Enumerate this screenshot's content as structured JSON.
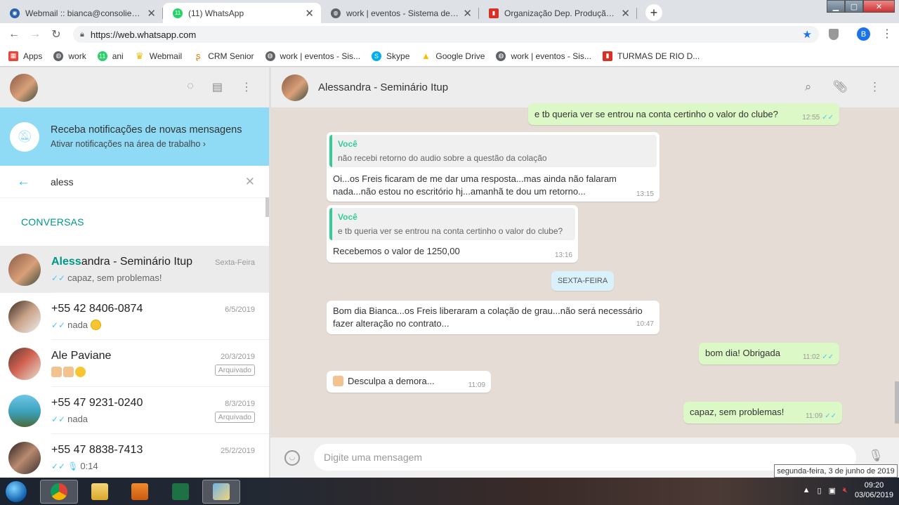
{
  "browser": {
    "tabs": [
      {
        "title": "Webmail :: bianca@consolievent...",
        "icon": "webmail-icon",
        "color": "#2a63a8",
        "active": false
      },
      {
        "title": "(11) WhatsApp",
        "icon": "whatsapp-icon",
        "color": "#25d366",
        "active": true
      },
      {
        "title": "work | eventos - Sistema de Gest...",
        "icon": "globe-icon",
        "color": "#5f6368",
        "active": false
      },
      {
        "title": "Organização Dep. Produção | Tre...",
        "icon": "trello-icon",
        "color": "#d93025",
        "active": false
      }
    ],
    "url": "https://web.whatsapp.com",
    "profile_initial": "B",
    "bookmarks": [
      {
        "label": "Apps",
        "icon": "apps-grid-icon",
        "color": "#e8453c"
      },
      {
        "label": "work",
        "icon": "globe-icon",
        "color": "#5f6368"
      },
      {
        "label": "ani",
        "icon": "whatsapp-icon",
        "color": "#25d366"
      },
      {
        "label": "Webmail",
        "icon": "crown-icon",
        "color": "#e6b800"
      },
      {
        "label": "CRM Senior",
        "icon": "crm-icon",
        "color": "#e07b00"
      },
      {
        "label": "work | eventos - Sis...",
        "icon": "globe-icon",
        "color": "#5f6368"
      },
      {
        "label": "Skype",
        "icon": "skype-icon",
        "color": "#00aff0"
      },
      {
        "label": "Google Drive",
        "icon": "drive-icon",
        "color": "#fbbc04"
      },
      {
        "label": "work | eventos - Sis...",
        "icon": "globe-icon",
        "color": "#5f6368"
      },
      {
        "label": "TURMAS DE RIO D...",
        "icon": "trello-icon",
        "color": "#d93025"
      }
    ]
  },
  "sidebar": {
    "notification": {
      "title": "Receba notificações de novas mensagens",
      "link": "Ativar notificações na área de trabalho ›"
    },
    "search_value": "aless",
    "section_title": "CONVERSAS",
    "chats": [
      {
        "name_match": "Aless",
        "name_rest": "andra - Seminário Itup",
        "date": "Sexta-Feira",
        "preview": "capaz, sem problemas!",
        "archived": "",
        "selected": true
      },
      {
        "name_match": "",
        "name_rest": "+55 42 8406-0874",
        "date": "6/5/2019",
        "preview": "nada",
        "archived": "",
        "selected": false
      },
      {
        "name_match": "",
        "name_rest": "Ale Paviane",
        "date": "20/3/2019",
        "preview": "",
        "archived": "Arquivado",
        "selected": false
      },
      {
        "name_match": "",
        "name_rest": "+55 47 9231-0240",
        "date": "8/3/2019",
        "preview": "nada",
        "archived": "Arquivado",
        "selected": false
      },
      {
        "name_match": "",
        "name_rest": "+55 47 8838-7413",
        "date": "25/2/2019",
        "preview": "0:14",
        "archived": "",
        "selected": false
      }
    ]
  },
  "conversation": {
    "contact_name": "Alessandra - Seminário Itup",
    "messages": [
      {
        "text": "e tb queria ver se entrou na conta certinho o valor do clube?",
        "time": "12:55"
      },
      {
        "quote_author": "Você",
        "quote_text": "não recebi retorno do audio sobre a questão da colação",
        "text1": "Oi...os Freis ficaram de me dar uma resposta...mas ainda não falaram",
        "text2": "nada...não estou no escritório hj...amanhã te dou um retorno...",
        "time": "13:15"
      },
      {
        "quote_author": "Você",
        "quote_text": "e tb queria ver se entrou na conta certinho o valor do clube?",
        "text": "Recebemos o valor de 1250,00",
        "time": "13:16"
      },
      {
        "text1": "Bom dia Bianca...os Freis liberaram a colação de grau...não será necessário",
        "text2": "fazer alteração no contrato...",
        "time": "10:47"
      },
      {
        "text": "bom dia! Obrigada",
        "time": "11:02"
      },
      {
        "text": "Desculpa a demora...",
        "time": "11:09"
      },
      {
        "text": "capaz, sem problemas!",
        "time": "11:09"
      }
    ],
    "date_chip": "SEXTA-FEIRA",
    "compose_placeholder": "Digite uma mensagem"
  },
  "tooltip": "segunda-feira, 3 de junho de 2019",
  "taskbar": {
    "time": "09:20",
    "date": "03/06/2019"
  }
}
